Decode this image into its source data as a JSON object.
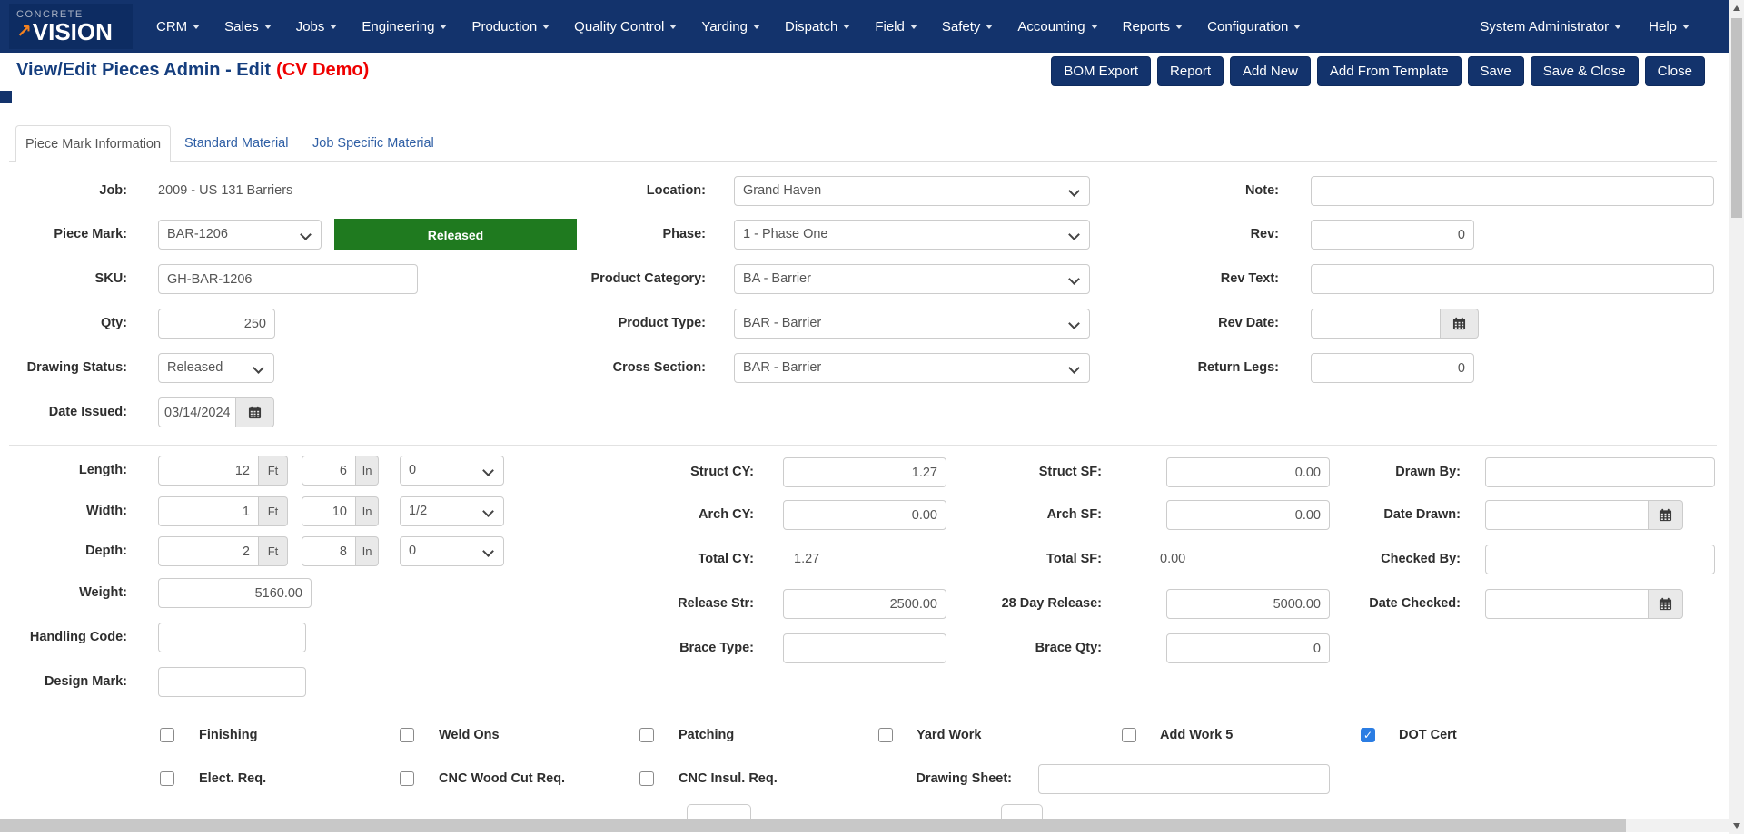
{
  "colors": {
    "navbar": "#13336c",
    "title_text": "#153e7e",
    "demo_red": "#ef0000",
    "released_green": "#1f7a1f",
    "checkbox_blue": "#2b7de3",
    "link_blue": "#2f5fa5"
  },
  "navbar": {
    "brand": {
      "line1": "CONCRETE",
      "line2": "VISION",
      "arrow": "↗"
    },
    "menus": [
      "CRM",
      "Sales",
      "Jobs",
      "Engineering",
      "Production",
      "Quality Control",
      "Yarding",
      "Dispatch",
      "Field",
      "Safety",
      "Accounting",
      "Reports",
      "Configuration"
    ],
    "right_menus": [
      "System Administrator",
      "Help"
    ]
  },
  "header": {
    "title": "View/Edit Pieces Admin - Edit",
    "demo": "(CV Demo)",
    "buttons": [
      "BOM Export",
      "Report",
      "Add New",
      "Add From Template",
      "Save",
      "Save & Close",
      "Close"
    ]
  },
  "tabs": [
    {
      "label": "Piece Mark Information",
      "active": true
    },
    {
      "label": "Standard Material",
      "active": false
    },
    {
      "label": "Job Specific Material",
      "active": false
    }
  ],
  "units": {
    "ft": "Ft",
    "in": "In"
  },
  "form": {
    "job": {
      "label": "Job:",
      "value": "2009 - US 131 Barriers"
    },
    "piece_mark": {
      "label": "Piece Mark:",
      "value": "BAR-1206",
      "status": "Released"
    },
    "sku": {
      "label": "SKU:",
      "value": "GH-BAR-1206"
    },
    "qty": {
      "label": "Qty:",
      "value": "250"
    },
    "drawing_status": {
      "label": "Drawing Status:",
      "value": "Released"
    },
    "date_issued": {
      "label": "Date Issued:",
      "value": "03/14/2024"
    },
    "location": {
      "label": "Location:",
      "value": "Grand Haven"
    },
    "phase": {
      "label": "Phase:",
      "value": "1 - Phase One"
    },
    "product_category": {
      "label": "Product Category:",
      "value": "BA - Barrier"
    },
    "product_type": {
      "label": "Product Type:",
      "value": "BAR - Barrier"
    },
    "cross_section": {
      "label": "Cross Section:",
      "value": "BAR - Barrier"
    },
    "note": {
      "label": "Note:",
      "value": ""
    },
    "rev": {
      "label": "Rev:",
      "value": "0"
    },
    "rev_text": {
      "label": "Rev Text:",
      "value": ""
    },
    "rev_date": {
      "label": "Rev Date:",
      "value": ""
    },
    "return_legs": {
      "label": "Return Legs:",
      "value": "0"
    },
    "length": {
      "label": "Length:",
      "ft": "12",
      "in": "6",
      "frac": "0"
    },
    "width": {
      "label": "Width:",
      "ft": "1",
      "in": "10",
      "frac": "1/2"
    },
    "depth": {
      "label": "Depth:",
      "ft": "2",
      "in": "8",
      "frac": "0"
    },
    "weight": {
      "label": "Weight:",
      "value": "5160.00"
    },
    "handling_code": {
      "label": "Handling Code:",
      "value": ""
    },
    "design_mark": {
      "label": "Design Mark:",
      "value": ""
    },
    "struct_cy": {
      "label": "Struct CY:",
      "value": "1.27"
    },
    "arch_cy": {
      "label": "Arch CY:",
      "value": "0.00"
    },
    "total_cy": {
      "label": "Total CY:",
      "value": "1.27"
    },
    "release_str": {
      "label": "Release Str:",
      "value": "2500.00"
    },
    "brace_type": {
      "label": "Brace Type:",
      "value": ""
    },
    "struct_sf": {
      "label": "Struct SF:",
      "value": "0.00"
    },
    "arch_sf": {
      "label": "Arch SF:",
      "value": "0.00"
    },
    "total_sf": {
      "label": "Total SF:",
      "value": "0.00"
    },
    "day28_release": {
      "label": "28 Day Release:",
      "value": "5000.00"
    },
    "brace_qty": {
      "label": "Brace Qty:",
      "value": "0"
    },
    "drawn_by": {
      "label": "Drawn By:",
      "value": ""
    },
    "date_drawn": {
      "label": "Date Drawn:",
      "value": ""
    },
    "checked_by": {
      "label": "Checked By:",
      "value": ""
    },
    "date_checked": {
      "label": "Date Checked:",
      "value": ""
    },
    "drawing_sheet": {
      "label": "Drawing Sheet:",
      "value": ""
    }
  },
  "checks": {
    "row1": [
      {
        "label": "Finishing",
        "checked": false
      },
      {
        "label": "Weld Ons",
        "checked": false
      },
      {
        "label": "Patching",
        "checked": false
      },
      {
        "label": "Yard Work",
        "checked": false
      },
      {
        "label": "Add Work 5",
        "checked": false
      },
      {
        "label": "DOT Cert",
        "checked": true
      }
    ],
    "row2": [
      {
        "label": "Elect. Req.",
        "checked": false
      },
      {
        "label": "CNC Wood Cut Req.",
        "checked": false
      },
      {
        "label": "CNC Insul. Req.",
        "checked": false
      }
    ]
  }
}
